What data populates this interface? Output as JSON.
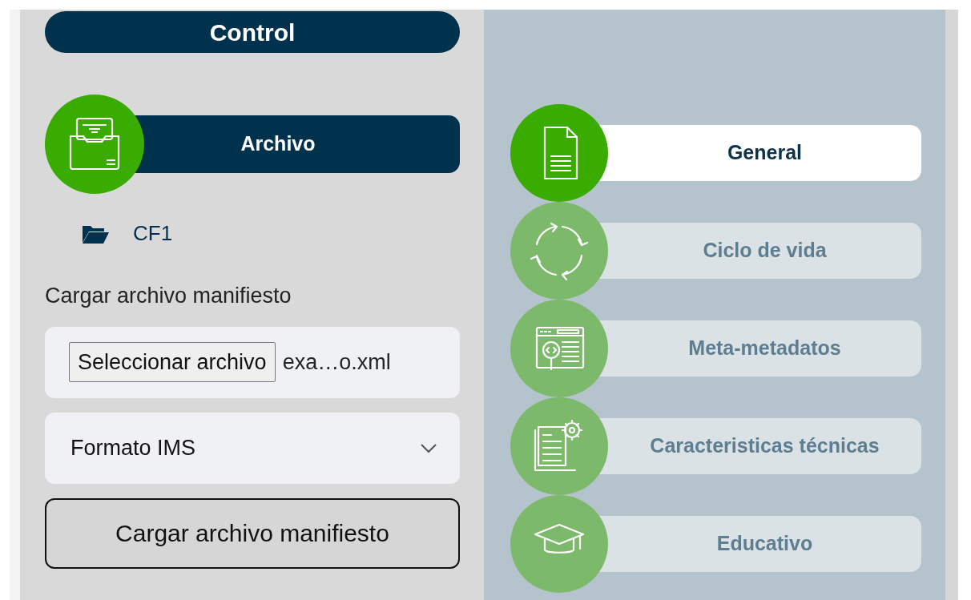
{
  "control_header": "Control",
  "section": {
    "label": "Archivo"
  },
  "folder": {
    "label": "CF1"
  },
  "upload": {
    "label": "Cargar archivo manifiesto",
    "file_button": "Seleccionar archivo",
    "file_name": "exa…o.xml",
    "format": "Formato IMS",
    "submit": "Cargar archivo manifiesto"
  },
  "categories": [
    {
      "label": "General",
      "kind": "document",
      "selected": true
    },
    {
      "label": "Ciclo de vida",
      "kind": "cycle",
      "selected": false
    },
    {
      "label": "Meta-metadatos",
      "kind": "webcode",
      "selected": false
    },
    {
      "label": "Caracteristicas técnicas",
      "kind": "docgear",
      "selected": false
    },
    {
      "label": "Educativo",
      "kind": "cap",
      "selected": false
    }
  ]
}
